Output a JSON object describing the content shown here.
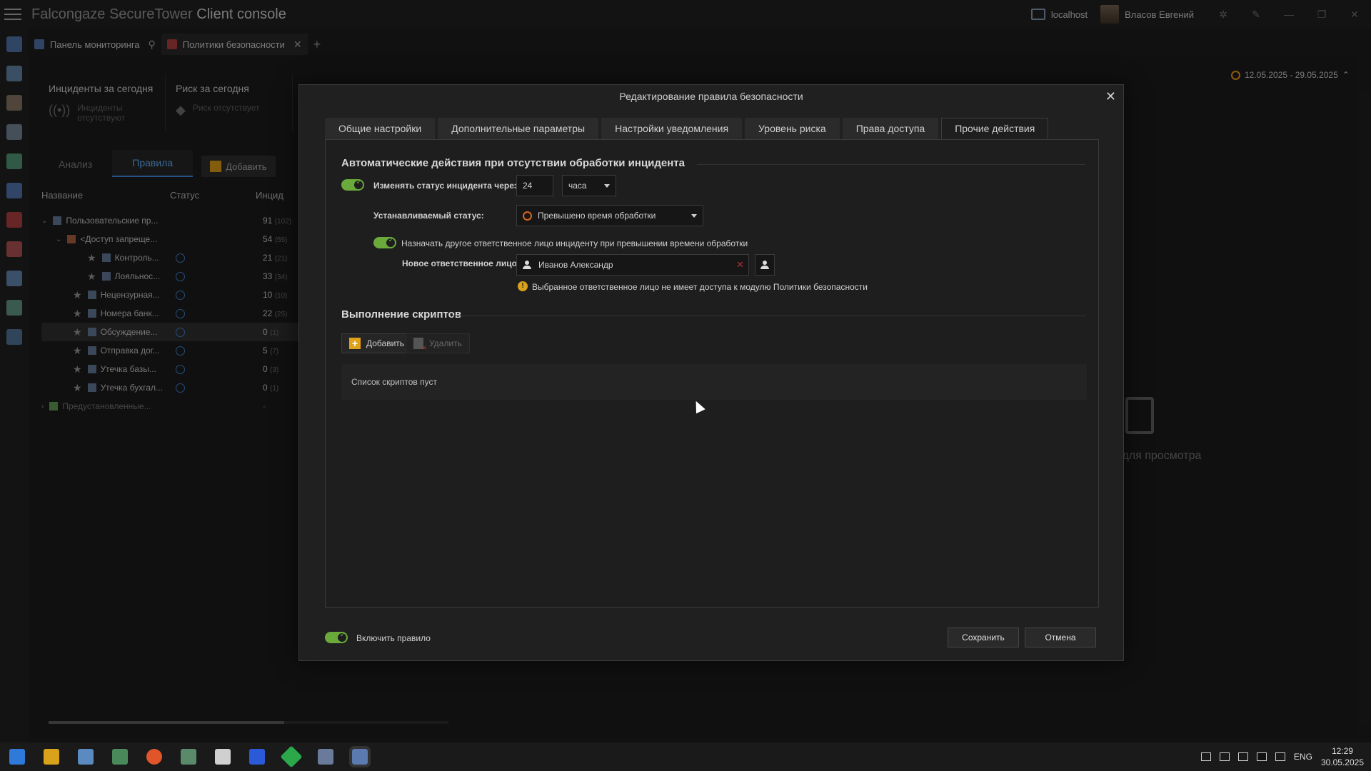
{
  "app": {
    "title_prefix": "Falcongaze SecureTower",
    "title_suffix": "Client console",
    "host": "localhost",
    "user": "Власов Евгений"
  },
  "doc_tabs": [
    {
      "label": "Панель мониторинга"
    },
    {
      "label": "Политики безопасности"
    }
  ],
  "background": {
    "cards": [
      {
        "title": "Инциденты за сегодня",
        "sub": "Инциденты отсутствуют"
      },
      {
        "title": "Риск за сегодня",
        "sub": "Риск отсутствует"
      }
    ],
    "tabs": [
      "Анализ",
      "Правила"
    ],
    "add_label": "Добавить",
    "columns": [
      "Название",
      "Статус",
      "Инцид"
    ],
    "date_range": "12.05.2025 - 29.05.2025",
    "empty_preview": "к для просмотра",
    "tree": [
      {
        "name": "Пользовательские пр...",
        "count": "91",
        "total": "(102)",
        "level": 0
      },
      {
        "name": "<Доступ запреще...",
        "count": "54",
        "total": "(55)",
        "level": 1
      },
      {
        "name": "Контроль...",
        "count": "21",
        "total": "(21)",
        "level": 2
      },
      {
        "name": "Лояльнос...",
        "count": "33",
        "total": "(34)",
        "level": 2
      },
      {
        "name": "Нецензурная...",
        "count": "10",
        "total": "(10)",
        "level": 1
      },
      {
        "name": "Номера банк...",
        "count": "22",
        "total": "(25)",
        "level": 1
      },
      {
        "name": "Обсуждение...",
        "count": "0",
        "total": "(1)",
        "level": 1
      },
      {
        "name": "Отправка дог...",
        "count": "5",
        "total": "(7)",
        "level": 1
      },
      {
        "name": "Утечка базы...",
        "count": "0",
        "total": "(3)",
        "level": 1
      },
      {
        "name": "Утечка бухгал...",
        "count": "0",
        "total": "(1)",
        "level": 1
      },
      {
        "name": "Предустановленные...",
        "count": "-",
        "total": "",
        "level": 0
      }
    ]
  },
  "dialog": {
    "title": "Редактирование правила безопасности",
    "tabs": [
      "Общие настройки",
      "Дополнительные параметры",
      "Настройки уведомления",
      "Уровень риска",
      "Права доступа",
      "Прочие действия"
    ],
    "active_tab": "Прочие действия",
    "section_auto": "Автоматические действия при отсутствии обработки инцидента",
    "change_status_label": "Изменять статус инцидента через",
    "change_status_value": "24",
    "change_status_unit": "часа",
    "set_status_label": "Устанавливаемый статус:",
    "set_status_value": "Превышено время обработки",
    "reassign_label": "Назначать другое ответственное лицо инциденту при превышении времени обработки",
    "new_person_label": "Новое ответственное лицо:",
    "new_person_value": "Иванов Александр",
    "warning": "Выбранное ответственное лицо не имеет доступа к модулю Политики безопасности",
    "section_scripts": "Выполнение скриптов",
    "add_label": "Добавить",
    "delete_label": "Удалить",
    "empty_scripts": "Список скриптов пуст",
    "enable_rule": "Включить правило",
    "save": "Сохранить",
    "cancel": "Отмена"
  },
  "taskbar": {
    "lang": "ENG",
    "time": "12:29",
    "date": "30.05.2025"
  },
  "colors": {
    "accent_blue": "#3c7fd0",
    "toggle_green": "#6aaa3a",
    "warning_yellow": "#d9a21a"
  }
}
